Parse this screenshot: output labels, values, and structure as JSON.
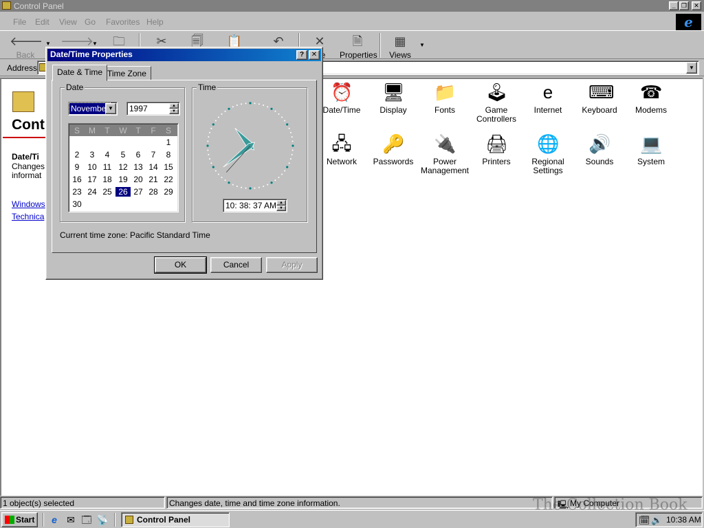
{
  "window": {
    "title": "Control Panel",
    "menu": [
      "File",
      "Edit",
      "View",
      "Go",
      "Favorites",
      "Help"
    ],
    "toolbar": {
      "back": "Back",
      "properties": "Properties",
      "views": "Views",
      "delete_partial": "ete"
    },
    "address": {
      "label": "Address"
    }
  },
  "left_pane": {
    "title": "Cont",
    "subtitle": "Date/Ti",
    "description": "Changes informat",
    "links": [
      "Windows",
      "Technica"
    ]
  },
  "icons": [
    {
      "label": "Date/Time",
      "icon": "clock-icon",
      "glyph": "⏰"
    },
    {
      "label": "Display",
      "icon": "monitor-icon",
      "glyph": "🖥"
    },
    {
      "label": "Fonts",
      "icon": "folder-fonts-icon",
      "glyph": "📁"
    },
    {
      "label": "Game Controllers",
      "icon": "joystick-icon",
      "glyph": "🕹"
    },
    {
      "label": "Internet",
      "icon": "internet-icon",
      "glyph": "e"
    },
    {
      "label": "Keyboard",
      "icon": "keyboard-icon",
      "glyph": "⌨"
    },
    {
      "label": "Modems",
      "icon": "modem-icon",
      "glyph": "☎"
    },
    {
      "label": "Network",
      "icon": "network-icon",
      "glyph": "🖧"
    },
    {
      "label": "Passwords",
      "icon": "keys-icon",
      "glyph": "🔑"
    },
    {
      "label": "Power Management",
      "icon": "power-icon",
      "glyph": "🔌"
    },
    {
      "label": "Printers",
      "icon": "printer-folder-icon",
      "glyph": "🖨"
    },
    {
      "label": "Regional Settings",
      "icon": "globe-icon",
      "glyph": "🌐"
    },
    {
      "label": "Sounds",
      "icon": "speaker-icon",
      "glyph": "🔊"
    },
    {
      "label": "System",
      "icon": "computer-icon",
      "glyph": "💻"
    }
  ],
  "status": {
    "selected": "1 object(s) selected",
    "info": "Changes date, time and time zone information.",
    "zone": "My Computer"
  },
  "taskbar": {
    "start": "Start",
    "task": "Control Panel",
    "clock": "10:38 AM"
  },
  "dialog": {
    "title": "Date/Time Properties",
    "help_btn": "?",
    "close_btn": "✕",
    "tabs": [
      "Date & Time",
      "Time Zone"
    ],
    "date_label": "Date",
    "time_label": "Time",
    "month": "November",
    "year": "1997",
    "weekdays": [
      "S",
      "M",
      "T",
      "W",
      "T",
      "F",
      "S"
    ],
    "calendar_rows": [
      [
        "",
        "",
        "",
        "",
        "",
        "",
        "1"
      ],
      [
        "2",
        "3",
        "4",
        "5",
        "6",
        "7",
        "8"
      ],
      [
        "9",
        "10",
        "11",
        "12",
        "13",
        "14",
        "15"
      ],
      [
        "16",
        "17",
        "18",
        "19",
        "20",
        "21",
        "22"
      ],
      [
        "23",
        "24",
        "25",
        "26",
        "27",
        "28",
        "29"
      ],
      [
        "30",
        "",
        "",
        "",
        "",
        "",
        ""
      ]
    ],
    "selected_day": "26",
    "time": "10: 38: 37 AM",
    "clock": {
      "hour": 10,
      "minute": 38,
      "second": 37
    },
    "timezone": "Current time zone:  Pacific Standard Time",
    "ok": "OK",
    "cancel": "Cancel",
    "apply": "Apply"
  },
  "watermark": "The Collection Book",
  "colors": {
    "face": "#c0c0c0",
    "titlebar_active": "#000080",
    "titlebar_inactive": "#808080",
    "clock_hand": "#3a9a9a"
  }
}
